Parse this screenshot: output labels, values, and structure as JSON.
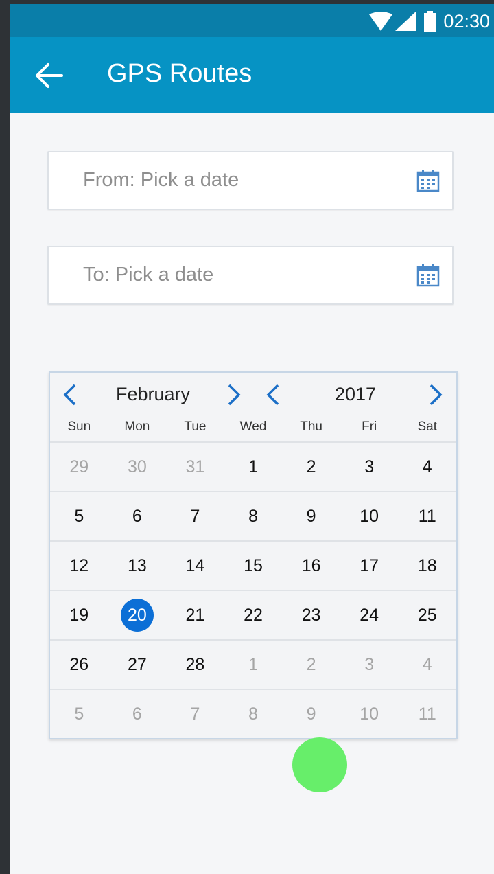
{
  "status_bar": {
    "time": "02:30",
    "icons": [
      "wifi-icon",
      "signal-icon",
      "battery-icon"
    ]
  },
  "app_bar": {
    "title": "GPS Routes",
    "back_icon": "back-arrow-icon"
  },
  "from_field": {
    "placeholder": "From: Pick a date",
    "icon": "calendar-icon"
  },
  "to_field": {
    "placeholder": "To: Pick a date",
    "icon": "calendar-icon"
  },
  "calendar": {
    "month": "February",
    "year": "2017",
    "weekdays": [
      "Sun",
      "Mon",
      "Tue",
      "Wed",
      "Thu",
      "Fri",
      "Sat"
    ],
    "weeks": [
      [
        {
          "d": "29",
          "m": true
        },
        {
          "d": "30",
          "m": true
        },
        {
          "d": "31",
          "m": true
        },
        {
          "d": "1"
        },
        {
          "d": "2"
        },
        {
          "d": "3"
        },
        {
          "d": "4"
        }
      ],
      [
        {
          "d": "5"
        },
        {
          "d": "6"
        },
        {
          "d": "7"
        },
        {
          "d": "8"
        },
        {
          "d": "9"
        },
        {
          "d": "10"
        },
        {
          "d": "11"
        }
      ],
      [
        {
          "d": "12"
        },
        {
          "d": "13"
        },
        {
          "d": "14"
        },
        {
          "d": "15"
        },
        {
          "d": "16"
        },
        {
          "d": "17"
        },
        {
          "d": "18"
        }
      ],
      [
        {
          "d": "19"
        },
        {
          "d": "20",
          "s": true
        },
        {
          "d": "21"
        },
        {
          "d": "22"
        },
        {
          "d": "23"
        },
        {
          "d": "24"
        },
        {
          "d": "25"
        }
      ],
      [
        {
          "d": "26"
        },
        {
          "d": "27"
        },
        {
          "d": "28"
        },
        {
          "d": "1",
          "m": true
        },
        {
          "d": "2",
          "m": true
        },
        {
          "d": "3",
          "m": true
        },
        {
          "d": "4",
          "m": true
        }
      ],
      [
        {
          "d": "5",
          "m": true
        },
        {
          "d": "6",
          "m": true
        },
        {
          "d": "7",
          "m": true
        },
        {
          "d": "8",
          "m": true
        },
        {
          "d": "9",
          "m": true
        },
        {
          "d": "10",
          "m": true
        },
        {
          "d": "11",
          "m": true
        }
      ]
    ]
  },
  "colors": {
    "app_bar": "#0693c4",
    "status_bar": "#0a7ea9",
    "selected_day": "#0c6fd6",
    "touch_indicator": "#67ee6a",
    "nav_chevron": "#1b6fc7"
  }
}
